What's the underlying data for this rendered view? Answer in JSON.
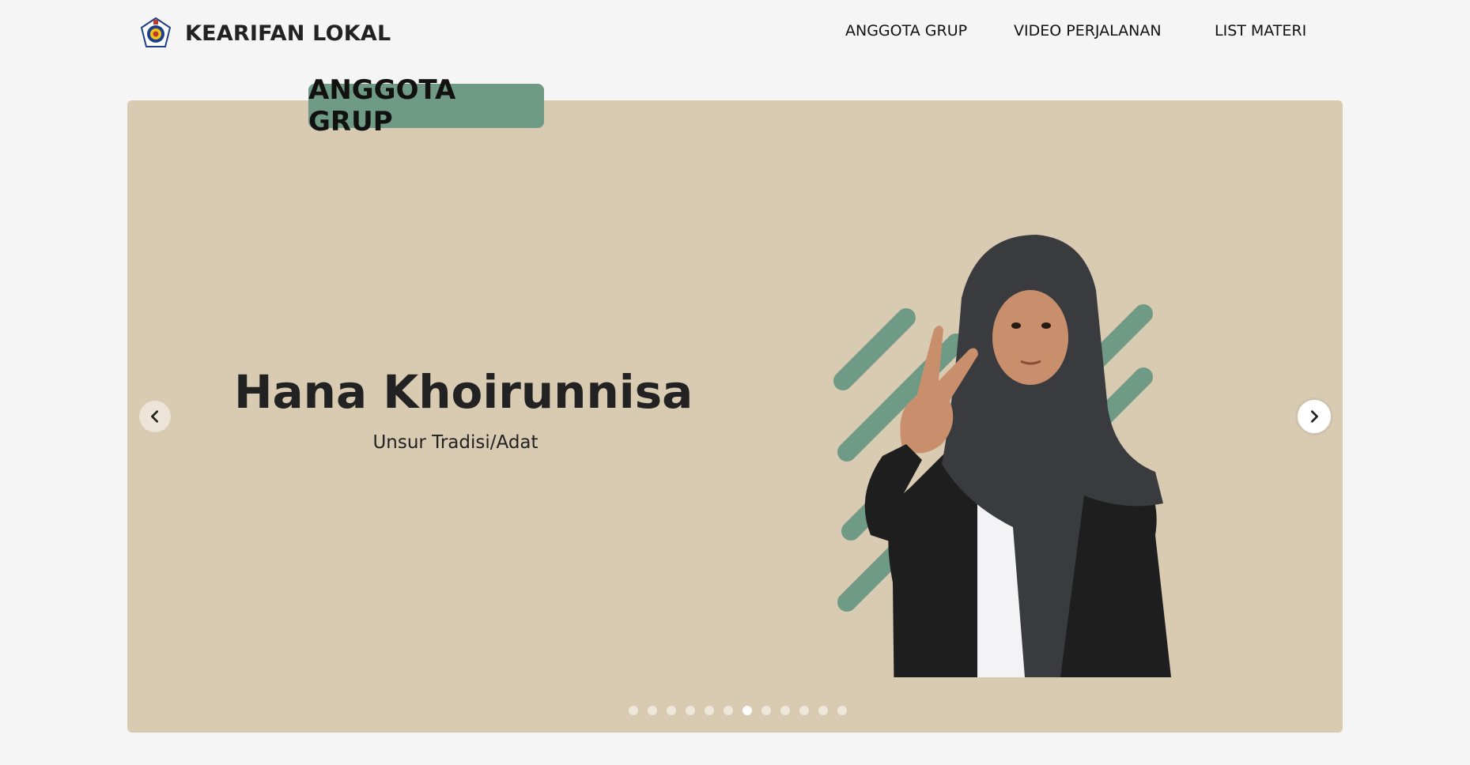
{
  "navbar": {
    "brand": "KEARIFAN LOKAL",
    "links": [
      "ANGGOTA GRUP",
      "VIDEO PERJALANAN",
      "LIST MATERI"
    ]
  },
  "slider": {
    "section_title": "ANGGOTA GRUP",
    "member_name": "Hana Khoirunnisa",
    "member_role": "Unsur Tradisi/Adat",
    "prev_icon": "chevron-left-icon",
    "next_icon": "chevron-right-icon",
    "indicator_count": 12,
    "active_indicator": 7
  },
  "colors": {
    "page_bg": "#f5f5f5",
    "slide_bg": "#d9cab2",
    "accent_green": "#6f9a85",
    "text_dark": "#222222",
    "hijab": "#3a3b3f",
    "outfit": "#1e1e1f",
    "shirt": "#f3f2f4",
    "skin": "#c98f6c"
  }
}
